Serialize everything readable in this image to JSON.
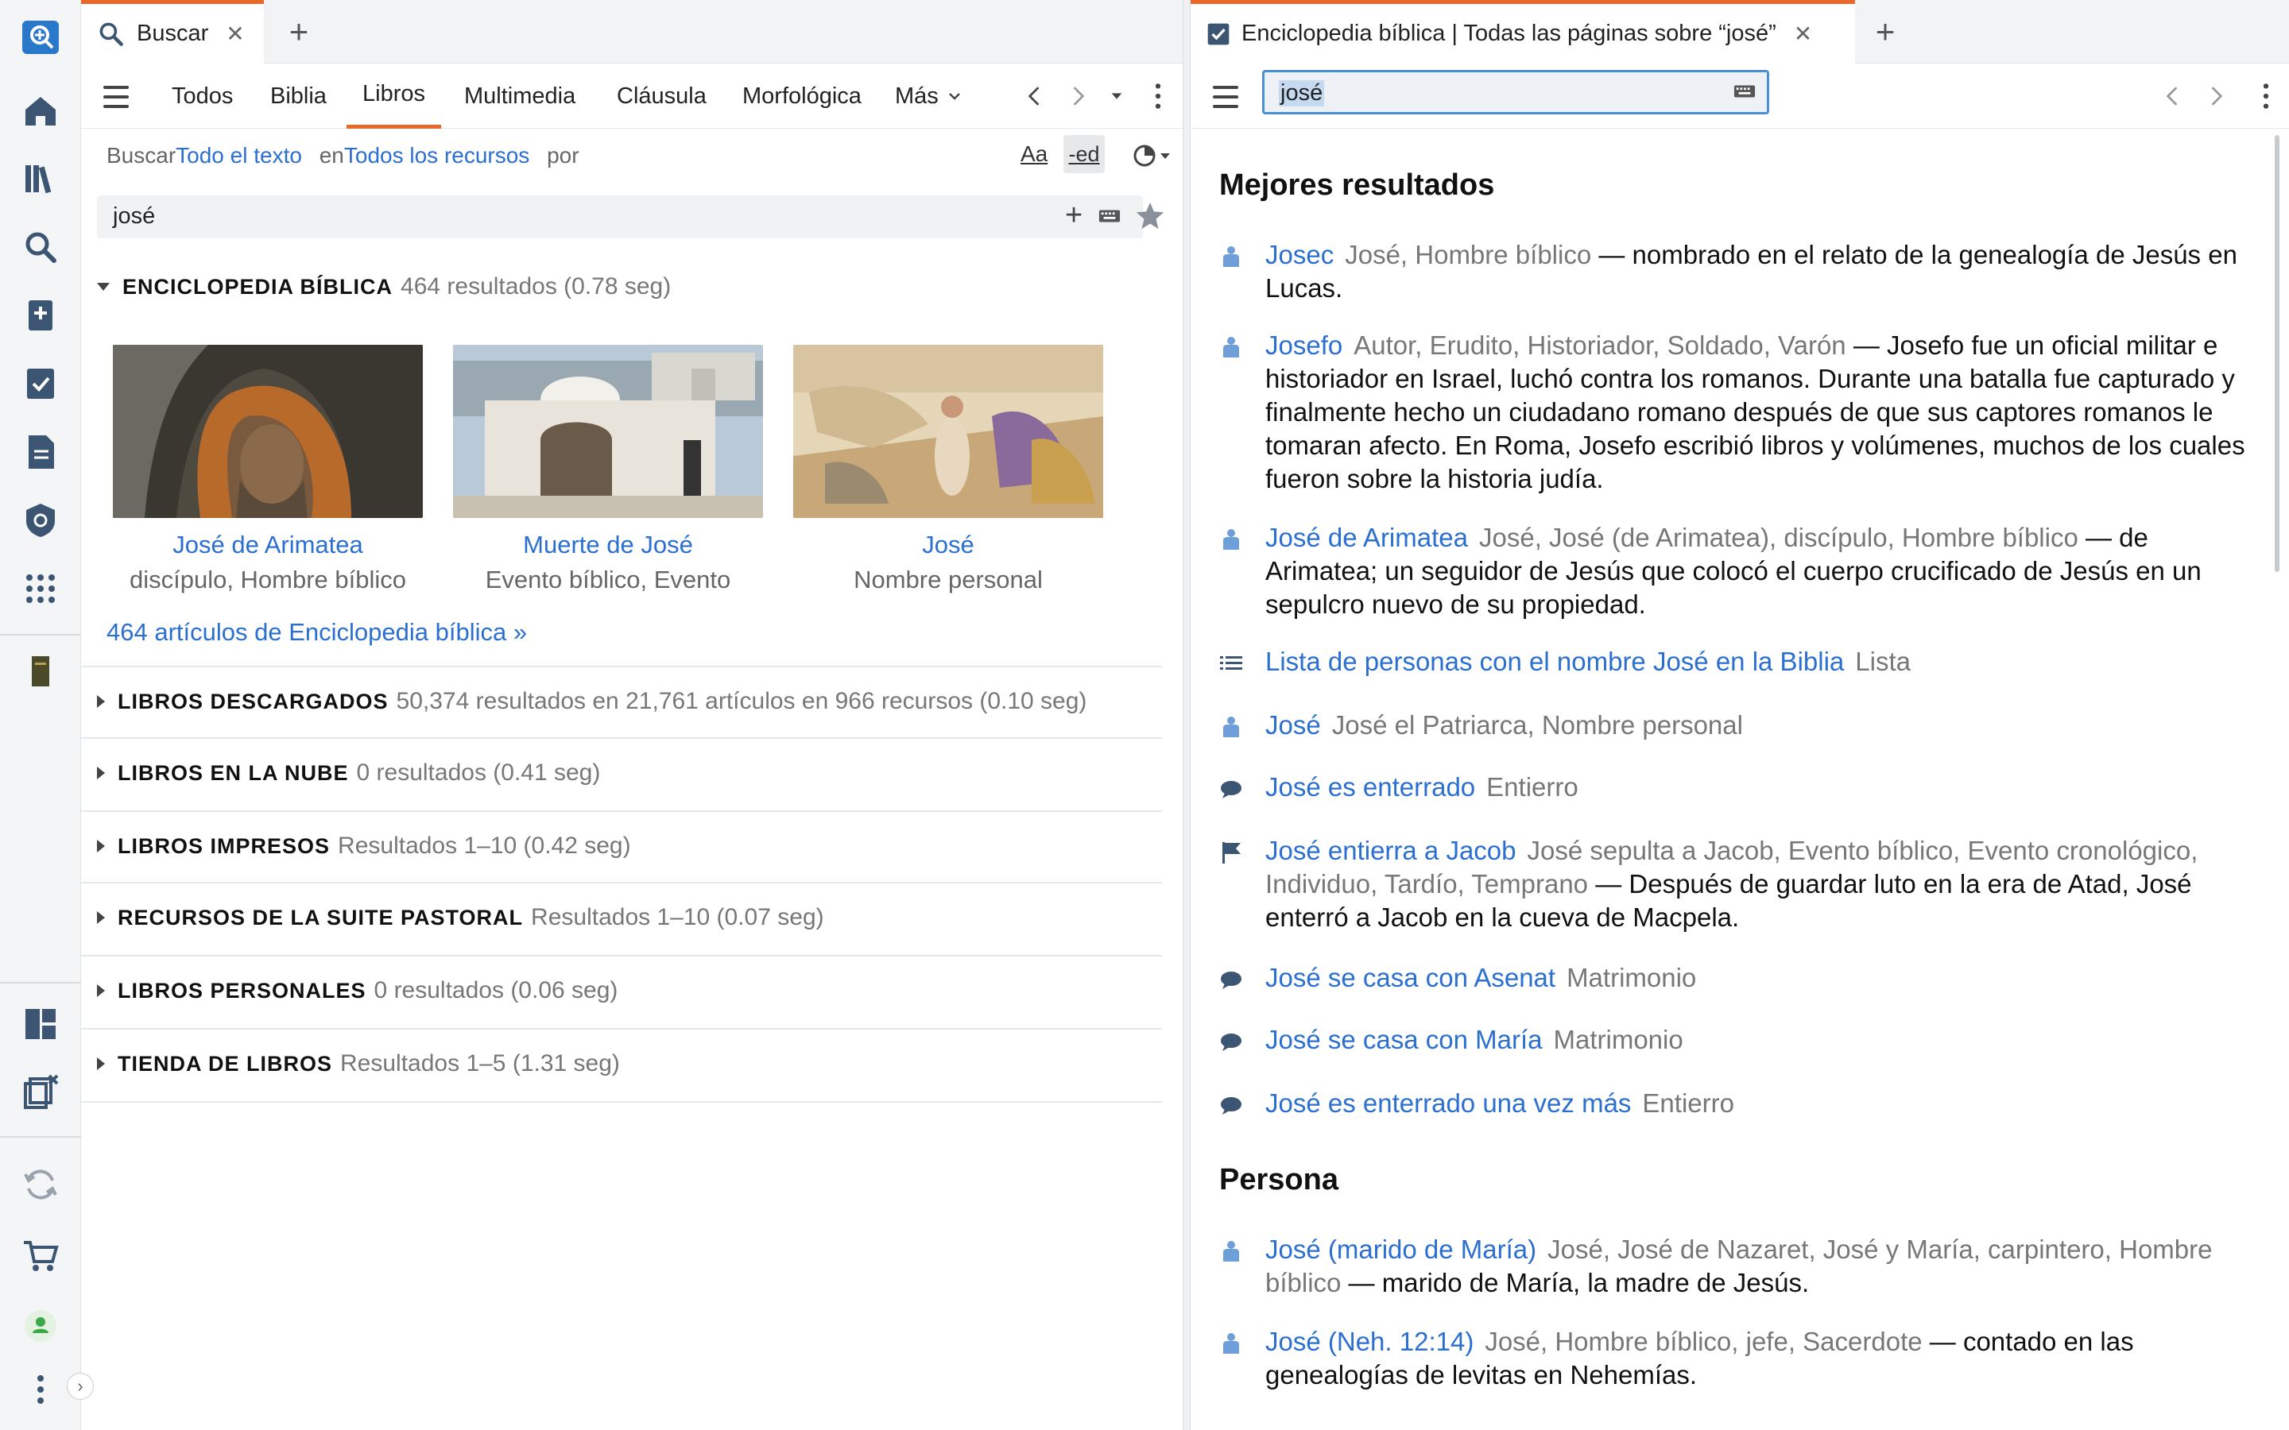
{
  "left_tab": {
    "label": "Buscar",
    "close": "✕",
    "add": "+"
  },
  "right_tab": {
    "label": "Enciclopedia bíblica | Todas las páginas sobre “josé”",
    "close": "✕",
    "add": "+"
  },
  "left_toolbar": {
    "tabs": [
      "Todos",
      "Biblia",
      "Libros",
      "Multimedia",
      "Cláusula",
      "Morfológica",
      "Más"
    ],
    "active": "Libros"
  },
  "search_by": {
    "prefix": "Buscar",
    "scope": "Todo el texto",
    "in": "en",
    "resources": "Todos los recursos",
    "by": "por"
  },
  "query": "josé",
  "options": {
    "case_label": "Aa",
    "stem_label": "-ed"
  },
  "encyclopedia_section": {
    "name": "ENCICLOPEDIA BÍBLICA",
    "meta": "464 resultados (0.78 seg)",
    "cards": [
      {
        "title": "José de Arimatea",
        "subtitle": "discípulo, Hombre bíblico"
      },
      {
        "title": "Muerte de José",
        "subtitle": "Evento bíblico, Evento"
      },
      {
        "title": "José",
        "subtitle": "Nombre personal"
      }
    ],
    "more": "464 artículos de Enciclopedia bíblica »"
  },
  "sections": [
    {
      "name": "LIBROS DESCARGADOS",
      "meta": "50,374 resultados en 21,761 artículos en 966 recursos (0.10 seg)"
    },
    {
      "name": "LIBROS EN LA NUBE",
      "meta": "0 resultados (0.41 seg)"
    },
    {
      "name": "LIBROS IMPRESOS",
      "meta": "Resultados 1–10 (0.42 seg)"
    },
    {
      "name": "RECURSOS DE LA SUITE PASTORAL",
      "meta": "Resultados 1–10 (0.07 seg)"
    },
    {
      "name": "LIBROS PERSONALES",
      "meta": "0 resultados (0.06 seg)"
    },
    {
      "name": "TIENDA DE LIBROS",
      "meta": "Resultados 1–5 (1.31 seg)"
    }
  ],
  "right_query": "josé",
  "best_results": {
    "heading": "Mejores resultados",
    "items": [
      {
        "icon": "person-icon",
        "title": "Josec",
        "meta": "José, Hombre bíblico",
        "desc": " — nombrado en el relato de la genealogía de Jesús en Lucas."
      },
      {
        "icon": "person-icon",
        "title": "Josefo",
        "meta": "Autor, Erudito, Historiador, Soldado, Varón",
        "desc": " — Josefo fue un oficial militar e historiador en Israel, luchó contra los romanos. Durante una batalla fue capturado y finalmente hecho un ciudadano romano después de que sus captores romanos le tomaran afecto. En Roma, Josefo escribió libros y volúmenes, muchos de los cuales fueron sobre la historia judía."
      },
      {
        "icon": "person-icon",
        "title": "José de Arimatea",
        "meta": "José, José (de Arimatea), discípulo, Hombre bíblico",
        "desc": " — de Arimatea; un seguidor de Jesús que colocó el cuerpo crucificado de Jesús en un sepulcro nuevo de su propiedad."
      },
      {
        "icon": "list-icon",
        "title": "Lista de personas con el nombre José en la Biblia",
        "meta": "Lista",
        "desc": ""
      },
      {
        "icon": "person-icon",
        "title": "José",
        "meta": "José el Patriarca, Nombre personal",
        "desc": ""
      },
      {
        "icon": "speech-icon",
        "title": "José es enterrado",
        "meta": "Entierro",
        "desc": ""
      },
      {
        "icon": "flag-icon",
        "title": "José entierra a Jacob",
        "meta": "José sepulta a Jacob, Evento bíblico, Evento cronológico, Individuo, Tardío, Temprano",
        "desc": " — Después de guardar luto en la era de Atad, José enterró a Jacob en la cueva de Macpela."
      },
      {
        "icon": "speech-icon",
        "title": "José se casa con Asenat",
        "meta": "Matrimonio",
        "desc": ""
      },
      {
        "icon": "speech-icon",
        "title": "José se casa con María",
        "meta": "Matrimonio",
        "desc": ""
      },
      {
        "icon": "speech-icon",
        "title": "José es enterrado una vez más",
        "meta": "Entierro",
        "desc": ""
      }
    ]
  },
  "person_results": {
    "heading": "Persona",
    "items": [
      {
        "icon": "person-icon",
        "title": "José (marido de María)",
        "meta": "José, José de Nazaret, José y María, carpintero, Hombre bíblico",
        "desc": " — marido de María, la madre de Jesús."
      },
      {
        "icon": "person-icon",
        "title": "José (Neh. 12:14)",
        "meta": "José, Hombre bíblico, jefe, Sacerdote",
        "desc": " — contado en las genealogías de levitas en Nehemías."
      }
    ]
  },
  "colors": {
    "accent": "#e8692a",
    "link": "#2b6fd0",
    "icon_blue": "#6f9fd8"
  }
}
